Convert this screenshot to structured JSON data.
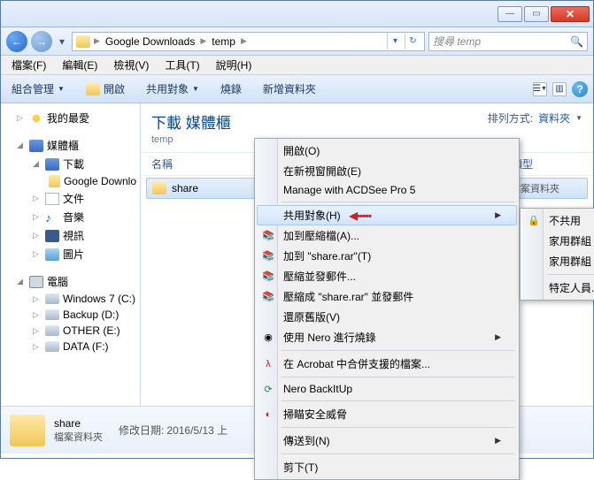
{
  "titlebar": {
    "min": "—",
    "max": "▭",
    "close": "✕"
  },
  "nav": {
    "crumbs": [
      "Google Downloads",
      "temp"
    ],
    "search_placeholder": "搜尋 temp"
  },
  "menubar": [
    "檔案(F)",
    "編輯(E)",
    "檢視(V)",
    "工具(T)",
    "說明(H)"
  ],
  "toolbar": {
    "organize": "組合管理",
    "open": "開啟",
    "share": "共用對象",
    "burn": "燒錄",
    "newfolder": "新增資料夾"
  },
  "sidebar": {
    "favorites": "我的最愛",
    "libraries": "媒體櫃",
    "downloads": "下載",
    "google_dl": "Google Downlo",
    "docs": "文件",
    "music": "音樂",
    "videos": "視訊",
    "pictures": "圖片",
    "computer": "電腦",
    "driveC": "Windows 7 (C:)",
    "driveD": "Backup (D:)",
    "driveE": "OTHER (E:)",
    "driveF": "DATA (F:)"
  },
  "main": {
    "title": "下載 媒體櫃",
    "subtitle": "temp",
    "sort_label": "排列方式:",
    "sort_value": "資料夾",
    "col_name": "名稱",
    "col_type": "類型",
    "file": "share",
    "file_type": "檔案資料夾"
  },
  "details": {
    "name": "share",
    "type": "檔案資料夾",
    "mod_label": "修改日期:",
    "mod_value": "2016/5/13 上"
  },
  "ctx": {
    "open": "開啟(O)",
    "open_new": "在新視窗開啟(E)",
    "acdsee": "Manage with ACDSee Pro 5",
    "share": "共用對象(H)",
    "add_rar": "加到壓縮檔(A)...",
    "add_share_rar": "加到 \"share.rar\"(T)",
    "compress_email": "壓縮並發郵件...",
    "compress_share_email": "壓縮成 \"share.rar\" 並發郵件",
    "restore": "還原舊版(V)",
    "nero_burn": "使用 Nero 進行燒錄",
    "acrobat": "在 Acrobat 中合併支援的檔案...",
    "nero_backup": "Nero BackItUp",
    "scan": "掃瞄安全威脅",
    "sendto": "傳送到(N)",
    "cut": "剪下(T)"
  },
  "submenu": {
    "nobody": "不共用",
    "homegroup_read": "家用群組 (讀取)",
    "homegroup_rw": "家用群組 (讀取/寫入",
    "specific": "特定人員..."
  }
}
